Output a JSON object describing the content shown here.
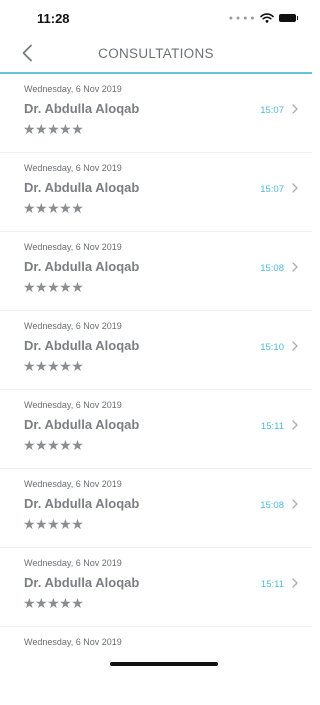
{
  "status_bar": {
    "time": "11:28"
  },
  "nav": {
    "title": "CONSULTATIONS"
  },
  "consultations": [
    {
      "date": "Wednesday, 6 Nov 2019",
      "doctor": "Dr. Abdulla Aloqab",
      "time": "15:07",
      "rating": "★★★★★"
    },
    {
      "date": "Wednesday, 6 Nov 2019",
      "doctor": "Dr. Abdulla Aloqab",
      "time": "15:07",
      "rating": "★★★★★"
    },
    {
      "date": "Wednesday, 6 Nov 2019",
      "doctor": "Dr. Abdulla Aloqab",
      "time": "15:08",
      "rating": "★★★★★"
    },
    {
      "date": "Wednesday, 6 Nov 2019",
      "doctor": "Dr. Abdulla Aloqab",
      "time": "15:10",
      "rating": "★★★★★"
    },
    {
      "date": "Wednesday, 6 Nov 2019",
      "doctor": "Dr. Abdulla Aloqab",
      "time": "15:11",
      "rating": "★★★★★"
    },
    {
      "date": "Wednesday, 6 Nov 2019",
      "doctor": "Dr. Abdulla Aloqab",
      "time": "15:08",
      "rating": "★★★★★"
    },
    {
      "date": "Wednesday, 6 Nov 2019",
      "doctor": "Dr. Abdulla Aloqab",
      "time": "15:11",
      "rating": "★★★★★"
    },
    {
      "date": "Wednesday, 6 Nov 2019"
    }
  ],
  "colors": {
    "accent": "#64c3d9",
    "time_text": "#4fb9d8",
    "star": "#8a8e92"
  },
  "icons": {
    "back": "chevron-left-icon",
    "row": "chevron-right-icon",
    "wifi": "wifi-icon",
    "battery": "battery-icon"
  }
}
